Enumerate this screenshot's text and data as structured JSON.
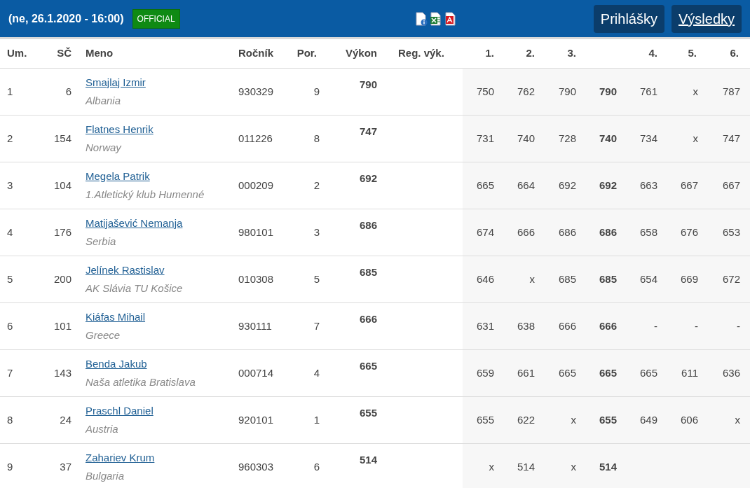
{
  "header": {
    "title": "(ne, 26.1.2020 - 16:00)",
    "badge": "OFFICIAL",
    "buttons": [
      {
        "label": "Prihlášky",
        "selected": false
      },
      {
        "label": "Výsledky",
        "selected": true
      }
    ]
  },
  "columns": [
    "Um.",
    "SČ",
    "Meno",
    "Ročník",
    "Por.",
    "Výkon",
    "Reg. výk.",
    "1.",
    "2.",
    "3.",
    "4.",
    "5.",
    "6."
  ],
  "rows": [
    {
      "rank": "1",
      "bib": "6",
      "name": "Smajlaj Izmir",
      "club": "Albania",
      "born": "930329",
      "order": "9",
      "result": "790",
      "attempts": [
        "750",
        "762",
        "790",
        "761",
        "x",
        "787"
      ],
      "best": "790"
    },
    {
      "rank": "2",
      "bib": "154",
      "name": "Flatnes Henrik",
      "club": "Norway",
      "born": "011226",
      "order": "8",
      "result": "747",
      "attempts": [
        "731",
        "740",
        "728",
        "734",
        "x",
        "747"
      ],
      "best": "740"
    },
    {
      "rank": "3",
      "bib": "104",
      "name": "Megela Patrik",
      "club": "1.Atletický klub Humenné",
      "born": "000209",
      "order": "2",
      "result": "692",
      "attempts": [
        "665",
        "664",
        "692",
        "663",
        "667",
        "667"
      ],
      "best": "692"
    },
    {
      "rank": "4",
      "bib": "176",
      "name": "Matijašević Nemanja",
      "club": "Serbia",
      "born": "980101",
      "order": "3",
      "result": "686",
      "attempts": [
        "674",
        "666",
        "686",
        "658",
        "676",
        "653"
      ],
      "best": "686"
    },
    {
      "rank": "5",
      "bib": "200",
      "name": "Jelínek Rastislav",
      "club": "AK Slávia TU Košice",
      "born": "010308",
      "order": "5",
      "result": "685",
      "attempts": [
        "646",
        "x",
        "685",
        "654",
        "669",
        "672"
      ],
      "best": "685"
    },
    {
      "rank": "6",
      "bib": "101",
      "name": "Kiáfas Mihail",
      "club": "Greece",
      "born": "930111",
      "order": "7",
      "result": "666",
      "attempts": [
        "631",
        "638",
        "666",
        "-",
        "-",
        "-"
      ],
      "best": "666"
    },
    {
      "rank": "7",
      "bib": "143",
      "name": "Benda Jakub",
      "club": "Naša atletika Bratislava",
      "born": "000714",
      "order": "4",
      "result": "665",
      "attempts": [
        "659",
        "661",
        "665",
        "665",
        "611",
        "636"
      ],
      "best": "665"
    },
    {
      "rank": "8",
      "bib": "24",
      "name": "Praschl Daniel",
      "club": "Austria",
      "born": "920101",
      "order": "1",
      "result": "655",
      "attempts": [
        "655",
        "622",
        "x",
        "649",
        "606",
        "x"
      ],
      "best": "655"
    },
    {
      "rank": "9",
      "bib": "37",
      "name": "Zahariev Krum",
      "club": "Bulgaria",
      "born": "960303",
      "order": "6",
      "result": "514",
      "attempts": [
        "x",
        "514",
        "x"
      ],
      "best": "514"
    }
  ]
}
